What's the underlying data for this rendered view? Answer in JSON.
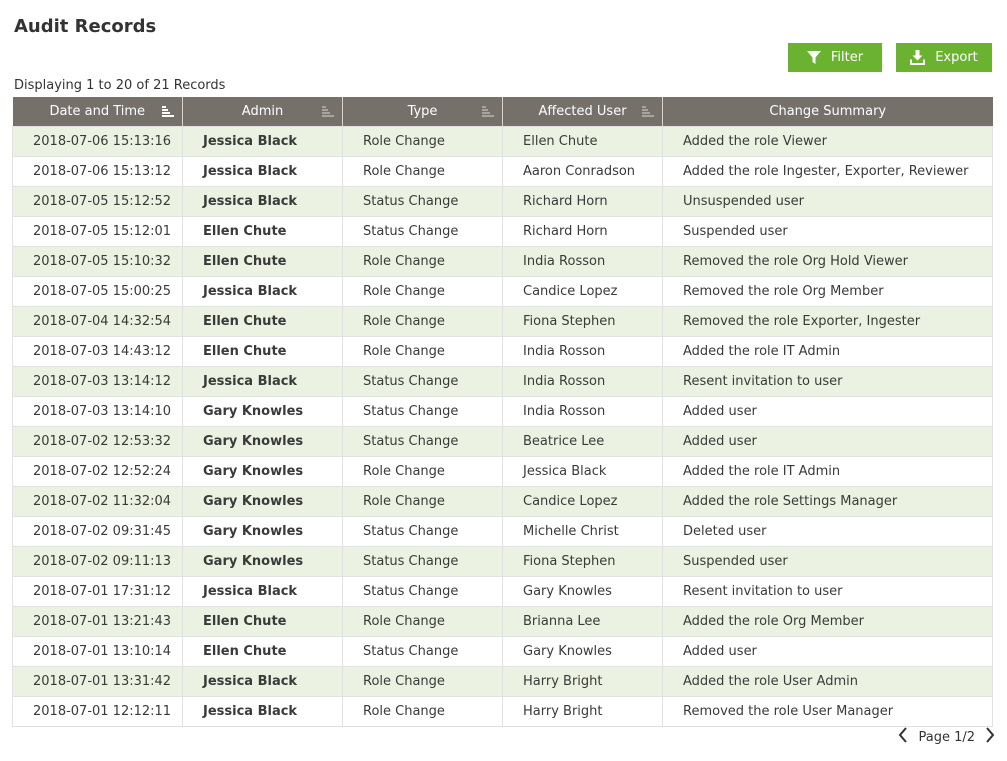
{
  "page": {
    "title": "Audit Records",
    "records_count": "Displaying 1 to 20 of 21 Records"
  },
  "toolbar": {
    "filter_label": "Filter",
    "export_label": "Export",
    "accent_color": "#6ab230"
  },
  "table": {
    "header_color": "#76706b",
    "alt_row_color": "#ebf2e2",
    "columns": [
      "Date and Time",
      "Admin",
      "Type",
      "Affected User",
      "Change Summary"
    ],
    "rows": [
      [
        "2018-07-06 15:13:16",
        "Jessica Black",
        "Role Change",
        "Ellen Chute",
        "Added the role Viewer"
      ],
      [
        "2018-07-06 15:13:12",
        "Jessica Black",
        "Role Change",
        "Aaron Conradson",
        "Added the role Ingester, Exporter, Reviewer"
      ],
      [
        "2018-07-05 15:12:52",
        "Jessica Black",
        "Status Change",
        "Richard Horn",
        "Unsuspended user"
      ],
      [
        "2018-07-05 15:12:01",
        "Ellen Chute",
        "Status Change",
        "Richard Horn",
        "Suspended user"
      ],
      [
        "2018-07-05 15:10:32",
        "Ellen Chute",
        "Role Change",
        "India Rosson",
        "Removed the role Org Hold Viewer"
      ],
      [
        "2018-07-05 15:00:25",
        "Jessica Black",
        "Role Change",
        "Candice Lopez",
        "Removed the role Org Member"
      ],
      [
        "2018-07-04 14:32:54",
        "Ellen Chute",
        "Role Change",
        "Fiona Stephen",
        "Removed the role Exporter, Ingester"
      ],
      [
        "2018-07-03 14:43:12",
        "Ellen Chute",
        "Role Change",
        "India Rosson",
        "Added the role IT Admin"
      ],
      [
        "2018-07-03 13:14:12",
        "Jessica Black",
        "Status Change",
        "India Rosson",
        "Resent invitation to user"
      ],
      [
        "2018-07-03 13:14:10",
        "Gary Knowles",
        "Status Change",
        "India Rosson",
        "Added user"
      ],
      [
        "2018-07-02 12:53:32",
        "Gary Knowles",
        "Status Change",
        "Beatrice Lee",
        "Added user"
      ],
      [
        "2018-07-02 12:52:24",
        "Gary Knowles",
        "Role Change",
        "Jessica Black",
        "Added the role IT Admin"
      ],
      [
        "2018-07-02 11:32:04",
        "Gary Knowles",
        "Role Change",
        "Candice Lopez",
        "Added the role Settings Manager"
      ],
      [
        "2018-07-02 09:31:45",
        "Gary Knowles",
        "Status Change",
        "Michelle Christ",
        "Deleted user"
      ],
      [
        "2018-07-02 09:11:13",
        "Gary Knowles",
        "Status Change",
        "Fiona Stephen",
        "Suspended user"
      ],
      [
        "2018-07-01 17:31:12",
        "Jessica Black",
        "Status Change",
        "Gary Knowles",
        "Resent invitation to user"
      ],
      [
        "2018-07-01 13:21:43",
        "Ellen Chute",
        "Role Change",
        "Brianna Lee",
        "Added the role Org Member"
      ],
      [
        "2018-07-01 13:10:14",
        "Ellen Chute",
        "Status Change",
        "Gary Knowles",
        "Added user"
      ],
      [
        "2018-07-01 13:31:42",
        "Jessica Black",
        "Role Change",
        "Harry Bright",
        "Added the role User Admin"
      ],
      [
        "2018-07-01 12:12:11",
        "Jessica Black",
        "Role Change",
        "Harry Bright",
        "Removed the role User Manager"
      ]
    ]
  },
  "pagination": {
    "label": "Page 1/2"
  }
}
